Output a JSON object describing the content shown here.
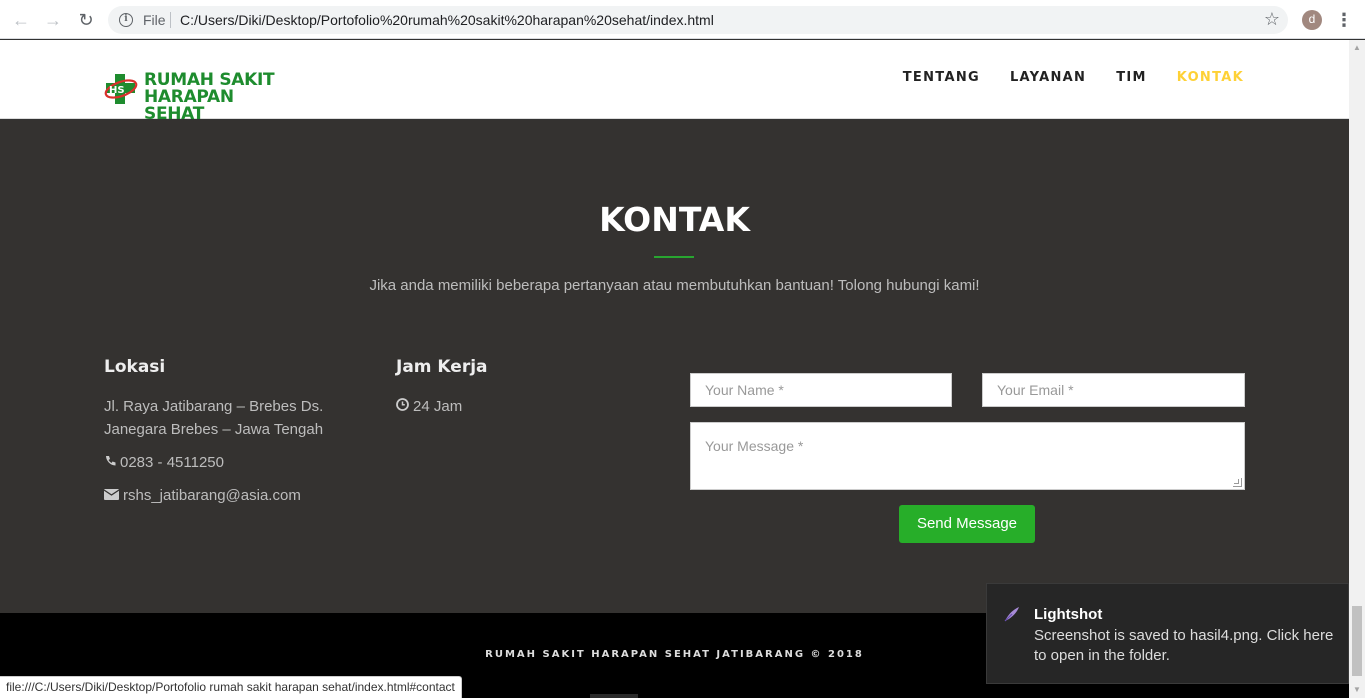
{
  "browser": {
    "scheme_label": "File",
    "url": "C:/Users/Diki/Desktop/Portofolio%20rumah%20sakit%20harapan%20sehat/index.html",
    "profile_initial": "d"
  },
  "site": {
    "logo_line1": "RUMAH SAKIT",
    "logo_line2": "HARAPAN SEHAT",
    "logo_mark_text": "HS",
    "menu": [
      "TENTANG",
      "LAYANAN",
      "TIM",
      "KONTAK"
    ],
    "active_menu": "KONTAK",
    "colors": {
      "brand_green": "#1e8c2e",
      "active_menu": "#fed136",
      "button": "#27ae29"
    }
  },
  "contact": {
    "title": "KONTAK",
    "lead": "Jika anda memiliki beberapa pertanyaan atau membutuhkan bantuan! Tolong hubungi kami!",
    "location": {
      "heading": "Lokasi",
      "address_line1": "Jl. Raya Jatibarang – Brebes Ds.",
      "address_line2": "Janegara Brebes – Jawa Tengah",
      "phone": "0283 - 4511250",
      "email": "rshs_jatibarang@asia.com"
    },
    "hours": {
      "heading": "Jam Kerja",
      "value": "24 Jam"
    },
    "form": {
      "name_placeholder": "Your Name *",
      "email_placeholder": "Your Email *",
      "message_placeholder": "Your Message *",
      "submit_label": "Send Message"
    }
  },
  "footer": {
    "copyright": "RUMAH SAKIT HARAPAN SEHAT JATIBARANG © 2018"
  },
  "status_bar": {
    "link": "file:///C:/Users/Diki/Desktop/Portofolio rumah sakit harapan sehat/index.html#contact"
  },
  "notification": {
    "app": "Lightshot",
    "message": "Screenshot is saved to hasil4.png. Click here to open in the folder."
  }
}
